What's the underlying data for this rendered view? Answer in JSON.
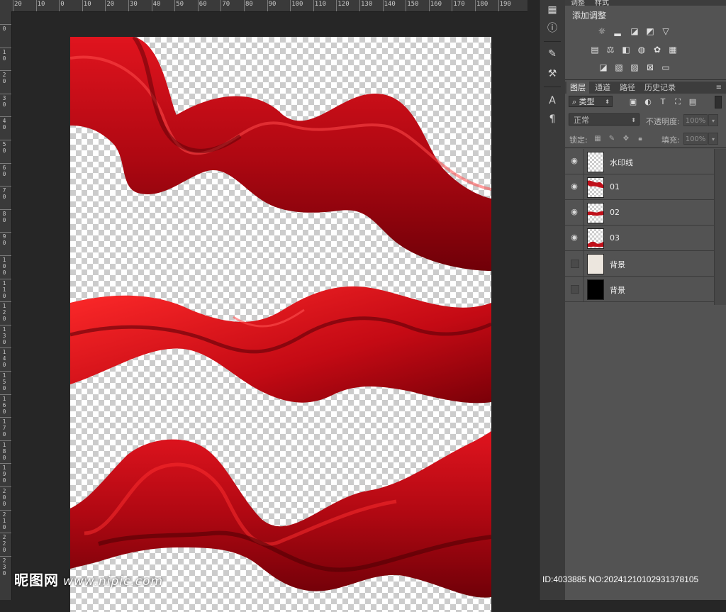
{
  "ruler_top_labels": [
    "20",
    "10",
    "0",
    "10",
    "20",
    "30",
    "40",
    "50",
    "60",
    "70",
    "80",
    "90",
    "100",
    "110",
    "120",
    "130",
    "140",
    "150",
    "160",
    "170",
    "180",
    "190"
  ],
  "ruler_left_labels": [
    "0",
    "1 0",
    "2 0",
    "3 0",
    "4 0",
    "5 0",
    "6 0",
    "7 0",
    "8 0",
    "9 0",
    "1 0 0",
    "1 1 0",
    "1 2 0",
    "1 3 0",
    "1 4 0",
    "1 5 0",
    "1 6 0",
    "1 7 0",
    "1 8 0",
    "1 9 0",
    "2 0 0",
    "2 1 0",
    "2 2 0",
    "2 3 0"
  ],
  "watermark": {
    "brand": "昵图网",
    "site": "www.nipic.com"
  },
  "id_text": "ID:4033885 NO:20241210102931378105",
  "adjustments": {
    "tabs": [
      "调整",
      "样式"
    ],
    "title": "添加调整",
    "icons_row1": [
      "brightness-icon",
      "levels-icon",
      "curves-icon",
      "exposure-icon",
      "triangle-icon"
    ],
    "icons_row2": [
      "vibrance-icon",
      "balance-icon",
      "bw-icon",
      "photo-filter-icon",
      "channel-mixer-icon",
      "lookup-grid-icon"
    ],
    "icons_row3": [
      "invert-icon",
      "posterize-icon",
      "threshold-icon",
      "selective-color-icon",
      "gradient-map-icon"
    ]
  },
  "layers_panel": {
    "tabs": [
      "图层",
      "通道",
      "路径",
      "历史记录"
    ],
    "active_tab": "图层",
    "filter_label": "类型",
    "blend_mode": "正常",
    "opacity_label": "不透明度:",
    "opacity_value": "100%",
    "lock_label": "锁定:",
    "fill_label": "填充:",
    "fill_value": "100%",
    "layers": [
      {
        "name": "水印线",
        "visible": true,
        "thumb": "transparent"
      },
      {
        "name": "01",
        "visible": true,
        "thumb": "ribbon"
      },
      {
        "name": "02",
        "visible": true,
        "thumb": "ribbon"
      },
      {
        "name": "03",
        "visible": true,
        "thumb": "ribbon"
      },
      {
        "name": "背景",
        "visible": false,
        "thumb": "light"
      },
      {
        "name": "背景",
        "visible": false,
        "thumb": "dark"
      }
    ]
  },
  "colors": {
    "ribbon": "#c8101a",
    "ribbon_dark": "#6e0008",
    "panel": "#535353",
    "workspace": "#262626"
  }
}
